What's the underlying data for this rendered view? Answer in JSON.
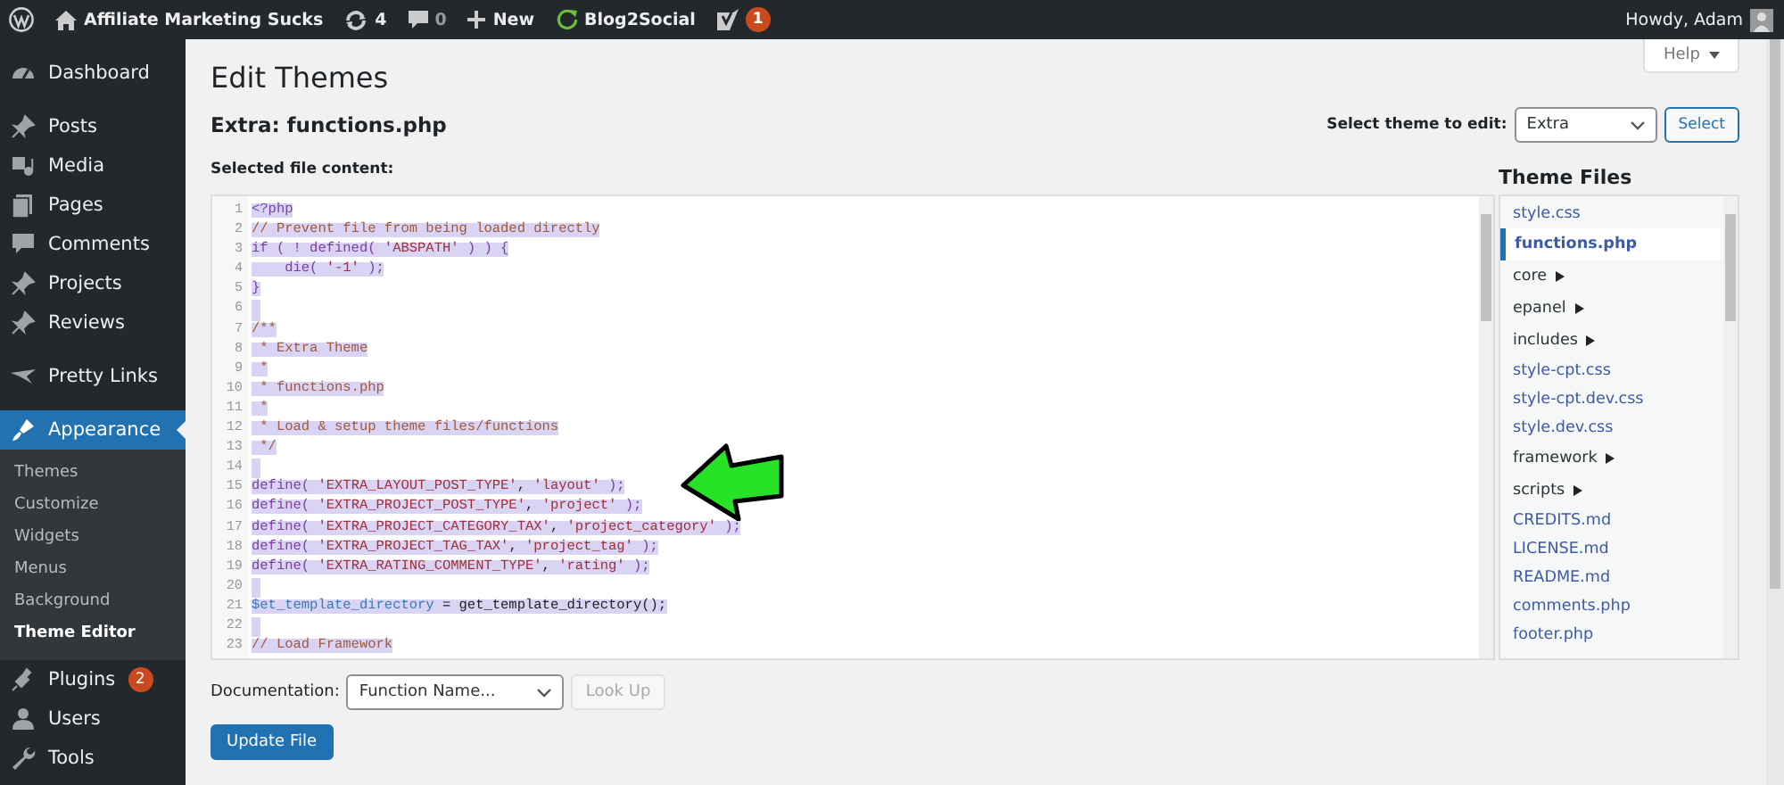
{
  "admin_bar": {
    "site_name": "Affiliate Marketing Sucks",
    "updates": "4",
    "comments": "0",
    "new": "New",
    "plugin": "Blog2Social",
    "seo_badge": "1",
    "greeting": "Howdy, Adam"
  },
  "sidebar": {
    "groups": [
      {
        "items": [
          {
            "label": "Dashboard",
            "selected": false
          }
        ]
      },
      {
        "items": [
          {
            "label": "Posts",
            "selected": false
          },
          {
            "label": "Media",
            "selected": false
          },
          {
            "label": "Pages",
            "selected": false
          },
          {
            "label": "Comments",
            "selected": false
          },
          {
            "label": "Projects",
            "selected": false
          },
          {
            "label": "Reviews",
            "selected": false
          }
        ]
      },
      {
        "items": [
          {
            "label": "Pretty Links",
            "selected": false
          }
        ]
      },
      {
        "items": [
          {
            "label": "Appearance",
            "selected": true,
            "children": [
              {
                "label": "Themes",
                "selected": false
              },
              {
                "label": "Customize",
                "selected": false
              },
              {
                "label": "Widgets",
                "selected": false
              },
              {
                "label": "Menus",
                "selected": false
              },
              {
                "label": "Background",
                "selected": false
              },
              {
                "label": "Theme Editor",
                "selected": true
              }
            ]
          },
          {
            "label": "Plugins",
            "selected": false,
            "badge": "2"
          },
          {
            "label": "Users",
            "selected": false
          },
          {
            "label": "Tools",
            "selected": false
          }
        ]
      }
    ]
  },
  "main": {
    "title": "Edit Themes",
    "help": "Help",
    "file_title": "Extra: functions.php",
    "theme_select": {
      "label": "Select theme to edit:",
      "value": "Extra",
      "button": "Select"
    },
    "content_label": "Selected file content:",
    "editor": {
      "selected": true,
      "lines": [
        {
          "n": "1",
          "tokens": [
            {
              "text": "<?php",
              "kind": "keyword"
            }
          ]
        },
        {
          "n": "2",
          "tokens": [
            {
              "text": "// Prevent file from being loaded directly",
              "kind": "comment"
            }
          ]
        },
        {
          "n": "3",
          "tokens": [
            {
              "text": "if ( ! defined( ",
              "kind": "keyword"
            },
            {
              "text": "'ABSPATH'",
              "kind": "string"
            },
            {
              "text": " ) ) {",
              "kind": "keyword"
            }
          ]
        },
        {
          "n": "4",
          "tokens": [
            {
              "text": "    die( ",
              "kind": "keyword"
            },
            {
              "text": "'-1'",
              "kind": "string"
            },
            {
              "text": " );",
              "kind": "keyword"
            }
          ]
        },
        {
          "n": "5",
          "tokens": [
            {
              "text": "}",
              "kind": "keyword"
            }
          ]
        },
        {
          "n": "6"
        },
        {
          "n": "7",
          "tokens": [
            {
              "text": "/**",
              "kind": "comment"
            }
          ]
        },
        {
          "n": "8",
          "tokens": [
            {
              "text": " * Extra Theme",
              "kind": "comment"
            }
          ]
        },
        {
          "n": "9",
          "tokens": [
            {
              "text": " *",
              "kind": "comment"
            }
          ]
        },
        {
          "n": "10",
          "tokens": [
            {
              "text": " * functions.php",
              "kind": "comment"
            }
          ]
        },
        {
          "n": "11",
          "tokens": [
            {
              "text": " *",
              "kind": "comment"
            }
          ]
        },
        {
          "n": "12",
          "tokens": [
            {
              "text": " * Load & setup theme files/functions",
              "kind": "comment"
            }
          ]
        },
        {
          "n": "13",
          "tokens": [
            {
              "text": " */",
              "kind": "comment"
            }
          ]
        },
        {
          "n": "14"
        },
        {
          "n": "15",
          "tokens": [
            {
              "text": "define( ",
              "kind": "keyword"
            },
            {
              "text": "'EXTRA_LAYOUT_POST_TYPE'",
              "kind": "string"
            },
            {
              "text": ", ",
              "kind": "plain"
            },
            {
              "text": "'layout'",
              "kind": "string"
            },
            {
              "text": " );",
              "kind": "keyword"
            }
          ]
        },
        {
          "n": "16",
          "tokens": [
            {
              "text": "define( ",
              "kind": "keyword"
            },
            {
              "text": "'EXTRA_PROJECT_POST_TYPE'",
              "kind": "string"
            },
            {
              "text": ", ",
              "kind": "plain"
            },
            {
              "text": "'project'",
              "kind": "string"
            },
            {
              "text": " );",
              "kind": "keyword"
            }
          ]
        },
        {
          "n": "17",
          "tokens": [
            {
              "text": "define( ",
              "kind": "keyword"
            },
            {
              "text": "'EXTRA_PROJECT_CATEGORY_TAX'",
              "kind": "string"
            },
            {
              "text": ", ",
              "kind": "plain"
            },
            {
              "text": "'project_category'",
              "kind": "string"
            },
            {
              "text": " );",
              "kind": "keyword"
            }
          ]
        },
        {
          "n": "18",
          "tokens": [
            {
              "text": "define( ",
              "kind": "keyword"
            },
            {
              "text": "'EXTRA_PROJECT_TAG_TAX'",
              "kind": "string"
            },
            {
              "text": ", ",
              "kind": "plain"
            },
            {
              "text": "'project_tag'",
              "kind": "string"
            },
            {
              "text": " );",
              "kind": "keyword"
            }
          ]
        },
        {
          "n": "19",
          "tokens": [
            {
              "text": "define( ",
              "kind": "keyword"
            },
            {
              "text": "'EXTRA_RATING_COMMENT_TYPE'",
              "kind": "string"
            },
            {
              "text": ", ",
              "kind": "plain"
            },
            {
              "text": "'rating'",
              "kind": "string"
            },
            {
              "text": " );",
              "kind": "keyword"
            }
          ]
        },
        {
          "n": "20"
        },
        {
          "n": "21",
          "tokens": [
            {
              "text": "$et_template_directory",
              "kind": "variable"
            },
            {
              "text": " = get_template_directory();",
              "kind": "plain"
            }
          ]
        },
        {
          "n": "22"
        },
        {
          "n": "23",
          "tokens": [
            {
              "text": "// Load Framework",
              "kind": "comment"
            }
          ]
        }
      ]
    },
    "theme_files": {
      "title": "Theme Files",
      "items": [
        {
          "label": "style.css",
          "kind": "file",
          "selected": false
        },
        {
          "label": "functions.php",
          "kind": "file",
          "selected": true
        },
        {
          "label": "core",
          "kind": "folder",
          "selected": false
        },
        {
          "label": "epanel",
          "kind": "folder",
          "selected": false
        },
        {
          "label": "includes",
          "kind": "folder",
          "selected": false
        },
        {
          "label": "style-cpt.css",
          "kind": "file",
          "selected": false
        },
        {
          "label": "style-cpt.dev.css",
          "kind": "file",
          "selected": false
        },
        {
          "label": "style.dev.css",
          "kind": "file",
          "selected": false
        },
        {
          "label": "framework",
          "kind": "folder",
          "selected": false
        },
        {
          "label": "scripts",
          "kind": "folder",
          "selected": false
        },
        {
          "label": "CREDITS.md",
          "kind": "file",
          "selected": false
        },
        {
          "label": "LICENSE.md",
          "kind": "file",
          "selected": false
        },
        {
          "label": "README.md",
          "kind": "file",
          "selected": false
        },
        {
          "label": "comments.php",
          "kind": "file",
          "selected": false
        },
        {
          "label": "footer.php",
          "kind": "file",
          "selected": false
        }
      ]
    },
    "documentation": {
      "label": "Documentation:",
      "value": "Function Name...",
      "lookup": {
        "label": "Look Up",
        "disabled": true
      }
    },
    "update_button": "Update File"
  }
}
